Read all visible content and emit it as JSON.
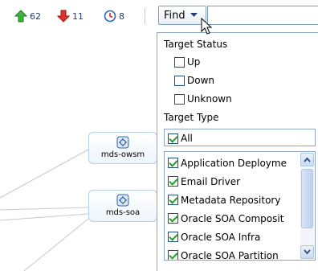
{
  "toolbar": {
    "up_count": "62",
    "down_count": "11",
    "unknown_count": "8",
    "find_label": "Find",
    "find_input_value": "",
    "icons": {
      "up": "green-up-arrow-icon",
      "down": "red-down-arrow-icon",
      "unknown": "clock-icon",
      "dropdown": "chevron-down-icon"
    }
  },
  "diagram": {
    "nodes": [
      {
        "label": "mds-owsm",
        "icon": "target-icon"
      },
      {
        "label": "mds-soa",
        "icon": "target-icon"
      }
    ]
  },
  "panel": {
    "status_title": "Target Status",
    "status_options": [
      {
        "label": "Up",
        "checked": false
      },
      {
        "label": "Down",
        "checked": false
      },
      {
        "label": "Unknown",
        "checked": false
      }
    ],
    "type_title": "Target Type",
    "all": {
      "label": "All",
      "checked": true
    },
    "types": [
      {
        "label": "Application Deployme",
        "checked": true
      },
      {
        "label": "Email Driver",
        "checked": true
      },
      {
        "label": "Metadata Repository",
        "checked": true
      },
      {
        "label": "Oracle SOA Composit",
        "checked": true
      },
      {
        "label": "Oracle SOA Infra",
        "checked": true
      },
      {
        "label": "Oracle SOA Partition",
        "checked": true
      }
    ]
  },
  "colors": {
    "up": "#2ca02c",
    "down": "#d62728",
    "check": "#21a121",
    "border": "#8aa5c6"
  }
}
